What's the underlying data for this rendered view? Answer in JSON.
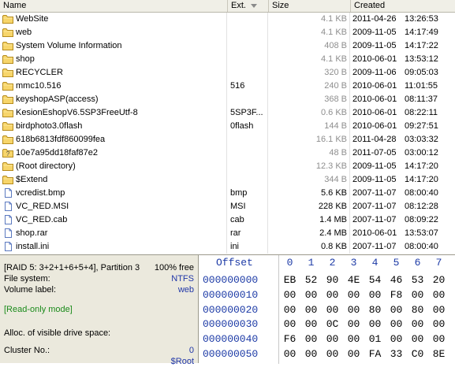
{
  "columns": {
    "name": "Name",
    "ext": "Ext.",
    "size": "Size",
    "created": "Created"
  },
  "files": [
    {
      "icon": "folder-icon",
      "name": "WebSite",
      "ext": "",
      "size": "4.1 KB",
      "date": "2011-04-26",
      "time": "13:26:53",
      "size_dark": false
    },
    {
      "icon": "folder-icon",
      "name": "web",
      "ext": "",
      "size": "4.1 KB",
      "date": "2009-11-05",
      "time": "14:17:49",
      "size_dark": false
    },
    {
      "icon": "folder-icon",
      "name": "System Volume Information",
      "ext": "",
      "size": "408 B",
      "date": "2009-11-05",
      "time": "14:17:22",
      "size_dark": false
    },
    {
      "icon": "folder-icon",
      "name": "shop",
      "ext": "",
      "size": "4.1 KB",
      "date": "2010-06-01",
      "time": "13:53:12",
      "size_dark": false
    },
    {
      "icon": "folder-icon",
      "name": "RECYCLER",
      "ext": "",
      "size": "320 B",
      "date": "2009-11-06",
      "time": "09:05:03",
      "size_dark": false
    },
    {
      "icon": "folder-icon",
      "name": "mmc10.516",
      "ext": "516",
      "size": "240 B",
      "date": "2010-06-01",
      "time": "11:01:55",
      "size_dark": false
    },
    {
      "icon": "folder-icon",
      "name": "keyshopASP(access)",
      "ext": "",
      "size": "368 B",
      "date": "2010-06-01",
      "time": "08:11:37",
      "size_dark": false
    },
    {
      "icon": "folder-icon",
      "name": "KesionEshopV6.5SP3FreeUtf-8",
      "ext": "5SP3F...",
      "size": "0.6 KB",
      "date": "2010-06-01",
      "time": "08:22:11",
      "size_dark": false
    },
    {
      "icon": "folder-icon",
      "name": "birdphoto3.0flash",
      "ext": "0flash",
      "size": "144 B",
      "date": "2010-06-01",
      "time": "09:27:51",
      "size_dark": false
    },
    {
      "icon": "folder-icon",
      "name": "618b6813fdf860099fea",
      "ext": "",
      "size": "16.1 KB",
      "date": "2011-04-28",
      "time": "03:03:32",
      "size_dark": false
    },
    {
      "icon": "unknown-file-icon",
      "name": "10e7a95dd18faf87e2",
      "ext": "",
      "size": "48 B",
      "date": "2011-07-05",
      "time": "03:00:12",
      "size_dark": false
    },
    {
      "icon": "folder-icon",
      "name": "(Root directory)",
      "ext": "",
      "size": "12.3 KB",
      "date": "2009-11-05",
      "time": "14:17:20",
      "size_dark": false
    },
    {
      "icon": "folder-icon",
      "name": "$Extend",
      "ext": "",
      "size": "344 B",
      "date": "2009-11-05",
      "time": "14:17:20",
      "size_dark": false
    },
    {
      "icon": "file-icon",
      "name": "vcredist.bmp",
      "ext": "bmp",
      "size": "5.6 KB",
      "date": "2007-11-07",
      "time": "08:00:40",
      "size_dark": true
    },
    {
      "icon": "file-icon",
      "name": "VC_RED.MSI",
      "ext": "MSI",
      "size": "228 KB",
      "date": "2007-11-07",
      "time": "08:12:28",
      "size_dark": true
    },
    {
      "icon": "file-icon",
      "name": "VC_RED.cab",
      "ext": "cab",
      "size": "1.4 MB",
      "date": "2007-11-07",
      "time": "08:09:22",
      "size_dark": true
    },
    {
      "icon": "file-icon",
      "name": "shop.rar",
      "ext": "rar",
      "size": "2.4 MB",
      "date": "2010-06-01",
      "time": "13:53:07",
      "size_dark": true
    },
    {
      "icon": "file-icon",
      "name": "install.ini",
      "ext": "ini",
      "size": "0.8 KB",
      "date": "2007-11-07",
      "time": "08:00:40",
      "size_dark": true
    }
  ],
  "info": {
    "raid_line": "[RAID 5: 3+2+1+6+5+4], Partition 3",
    "free": "100% free",
    "fs_label": "File system:",
    "fs_value": "NTFS",
    "vol_label": "Volume label:",
    "vol_value": "web",
    "mode": "[Read-only mode]",
    "alloc": "Alloc. of visible drive space:",
    "cluster_label": "Cluster No.:",
    "cluster_value": "0",
    "root_hint": "$Root"
  },
  "hex": {
    "offset_label": "Offset",
    "cols": [
      "0",
      "1",
      "2",
      "3",
      "4",
      "5",
      "6",
      "7"
    ],
    "rows": [
      {
        "addr": "000000000",
        "bytes": [
          "EB",
          "52",
          "90",
          "4E",
          "54",
          "46",
          "53",
          "20"
        ]
      },
      {
        "addr": "000000010",
        "bytes": [
          "00",
          "00",
          "00",
          "00",
          "00",
          "F8",
          "00",
          "00"
        ]
      },
      {
        "addr": "000000020",
        "bytes": [
          "00",
          "00",
          "00",
          "00",
          "80",
          "00",
          "80",
          "00"
        ]
      },
      {
        "addr": "000000030",
        "bytes": [
          "00",
          "00",
          "0C",
          "00",
          "00",
          "00",
          "00",
          "00"
        ]
      },
      {
        "addr": "000000040",
        "bytes": [
          "F6",
          "00",
          "00",
          "00",
          "01",
          "00",
          "00",
          "00"
        ]
      },
      {
        "addr": "000000050",
        "bytes": [
          "00",
          "00",
          "00",
          "00",
          "FA",
          "33",
          "C0",
          "8E"
        ]
      }
    ]
  }
}
